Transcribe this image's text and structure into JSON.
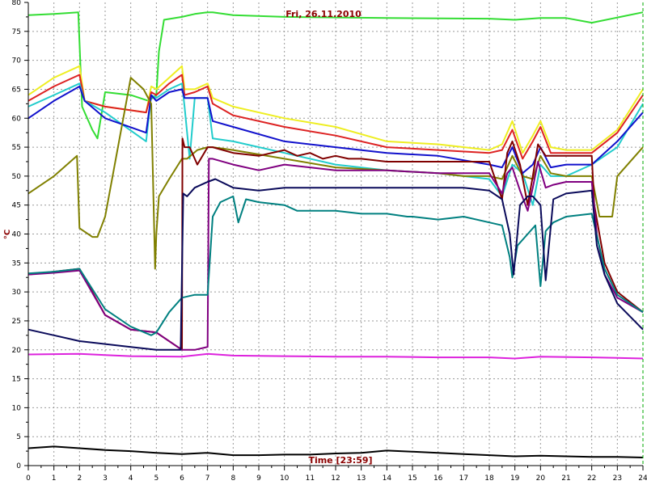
{
  "chart_data": {
    "type": "line",
    "title": "Fri, 26.11.2010",
    "xlabel": "Time [23:59]",
    "ylabel": "°C",
    "xlim": [
      0,
      24
    ],
    "ylim": [
      0,
      80
    ],
    "grid": true,
    "colors": {
      "title": "#8b0000",
      "xlabel": "#8b0000",
      "ylabel": "#8b0000",
      "grid": "#9a9a9a",
      "axis": "#000000",
      "right_edge": "#00aa00"
    },
    "series": [
      {
        "color": "#33dd33",
        "x": [
          0,
          1,
          1.95,
          2.1,
          2.5,
          2.7,
          3,
          4,
          4.7,
          5,
          5.1,
          5.3,
          6,
          6.5,
          7,
          7.2,
          8,
          10,
          14,
          18,
          19,
          20,
          21,
          22,
          24
        ],
        "y": [
          77.8,
          78,
          78.3,
          62,
          58,
          56.5,
          64.5,
          64,
          63,
          64,
          71.5,
          77,
          77.5,
          78,
          78.3,
          78.3,
          77.8,
          77.5,
          77.3,
          77.2,
          77,
          77.3,
          77.3,
          76.5,
          78.3
        ]
      },
      {
        "color": "#eeee22",
        "x": [
          0,
          1,
          2,
          2.2,
          3,
          4.6,
          4.8,
          5,
          5.5,
          6,
          6.1,
          6.5,
          7,
          7.2,
          8,
          10,
          12,
          14,
          16,
          18,
          18.5,
          18.9,
          19.3,
          19.7,
          20,
          20.4,
          21,
          22,
          23,
          24
        ],
        "y": [
          64,
          67,
          69,
          63,
          62,
          61,
          65.5,
          65,
          67,
          69,
          65,
          65,
          66,
          63.5,
          62,
          60,
          58.5,
          56,
          55.5,
          54.5,
          55.5,
          59.5,
          54,
          57,
          59.5,
          55,
          54.5,
          54.5,
          58,
          65
        ]
      },
      {
        "color": "#dd2222",
        "x": [
          0,
          1,
          2,
          2.2,
          3,
          4.6,
          4.8,
          5,
          5.5,
          6,
          6.1,
          6.5,
          7,
          7.2,
          8,
          10,
          12,
          14,
          16,
          18,
          18.5,
          18.9,
          19.3,
          19.7,
          20,
          20.4,
          21,
          22,
          23,
          24
        ],
        "y": [
          63,
          65.5,
          67.5,
          63,
          62,
          61,
          64.5,
          64,
          66,
          67.5,
          64,
          64.5,
          65.5,
          62.5,
          60.5,
          58.5,
          57,
          55,
          54.5,
          54,
          54.5,
          58,
          53,
          56,
          58.5,
          54,
          54,
          54,
          57.5,
          64
        ]
      },
      {
        "color": "#22cccc",
        "x": [
          0,
          1,
          2,
          2.2,
          3,
          4.6,
          4.8,
          5,
          5.5,
          6,
          6.1,
          6.3,
          6.5,
          7,
          7.2,
          8,
          10,
          12,
          14,
          16,
          18,
          18.5,
          18.9,
          19.3,
          19.7,
          20,
          20.4,
          21,
          22,
          23,
          24
        ],
        "y": [
          62,
          64,
          66,
          63,
          61,
          56,
          64,
          63.5,
          65,
          66,
          62,
          53,
          63.5,
          63.5,
          56.5,
          56,
          54,
          52,
          51,
          50.5,
          49.5,
          46.5,
          52,
          50.5,
          45,
          52,
          50,
          50,
          52,
          55,
          62.5
        ]
      },
      {
        "color": "#1111cc",
        "x": [
          0,
          1,
          2,
          2.2,
          3,
          4.6,
          4.8,
          5,
          5.5,
          6,
          6.1,
          6.5,
          7,
          7.2,
          8,
          10,
          12,
          14,
          16,
          18,
          18.5,
          18.9,
          19.3,
          19.7,
          20,
          20.4,
          21,
          22,
          23,
          24
        ],
        "y": [
          60,
          63,
          65.5,
          63,
          60,
          57.5,
          64,
          63,
          64.5,
          65,
          63.5,
          63.5,
          63.5,
          59.5,
          58.5,
          56,
          55,
          54,
          53.5,
          52,
          51.5,
          55,
          50.5,
          52,
          55,
          51.5,
          52,
          52,
          56,
          61
        ]
      },
      {
        "color": "#808000",
        "x": [
          0,
          1,
          1.9,
          2,
          2.5,
          2.7,
          3,
          4,
          4.5,
          4.8,
          4.95,
          5,
          5.1,
          5.5,
          6,
          6.2,
          6.6,
          7,
          7.2,
          8,
          10,
          12,
          14,
          16,
          17,
          18,
          18.5,
          18.9,
          19.3,
          19.7,
          20,
          20.4,
          21,
          22,
          22.3,
          22.8,
          23,
          24
        ],
        "y": [
          47,
          50,
          53.5,
          41,
          39.5,
          39.5,
          43,
          67,
          65,
          62.5,
          34,
          40,
          46.5,
          49.5,
          53,
          53,
          54.5,
          55,
          55,
          54.5,
          53,
          51.5,
          51,
          50.5,
          50,
          50,
          49.5,
          53.5,
          50,
          49.5,
          53.5,
          50.5,
          50,
          50,
          43,
          43,
          50,
          55
        ]
      },
      {
        "color": "#800000",
        "x": [
          0,
          1,
          2,
          3,
          4,
          5,
          6,
          6.02,
          6.1,
          6.3,
          6.6,
          7,
          7.2,
          8,
          9,
          10,
          10.5,
          11,
          11.5,
          12,
          12.5,
          13,
          14,
          15,
          16,
          17,
          18,
          18.5,
          18.7,
          18.9,
          19.2,
          19.5,
          19.7,
          19.9,
          20.2,
          20.5,
          21,
          22,
          22.1,
          22.5,
          23,
          24
        ],
        "y": [
          33,
          33.5,
          34,
          26,
          23.5,
          23,
          20,
          56.5,
          55,
          55,
          52,
          55,
          55,
          54,
          53.5,
          54.5,
          53.5,
          54,
          53,
          53.5,
          53,
          53,
          52.5,
          52.5,
          52.5,
          52.5,
          52.5,
          46,
          54,
          56,
          52,
          45,
          50,
          55.5,
          53.5,
          53.5,
          53.5,
          53.5,
          45,
          35,
          30,
          26.5
        ]
      },
      {
        "color": "#800080",
        "x": [
          0,
          1,
          2,
          3,
          4,
          5,
          6,
          6.1,
          6.5,
          7,
          7.05,
          7.2,
          8,
          9,
          10,
          11,
          12,
          14,
          16,
          18,
          18.5,
          18.7,
          18.9,
          19.2,
          19.5,
          19.7,
          19.9,
          20.2,
          20.5,
          21,
          22,
          22.2,
          22.5,
          23,
          24
        ],
        "y": [
          33,
          33.3,
          33.7,
          26,
          23.5,
          23,
          20,
          20,
          20,
          20.5,
          53,
          53,
          52,
          51,
          52,
          51.5,
          51,
          51,
          50.5,
          50.5,
          47,
          50.5,
          51.5,
          47.5,
          44,
          48,
          52.5,
          48,
          48.5,
          49,
          49,
          40,
          33,
          29,
          26.5
        ]
      },
      {
        "color": "#008080",
        "x": [
          0,
          1,
          2,
          3,
          4,
          4.8,
          5,
          5.5,
          6,
          6.5,
          7,
          7.2,
          7.5,
          8,
          8.2,
          8.5,
          9,
          10,
          10.5,
          11,
          12,
          13,
          14,
          14.8,
          15,
          16,
          17,
          18,
          18.5,
          18.8,
          18.9,
          19.1,
          19.5,
          19.8,
          20,
          20.2,
          20.5,
          21,
          22,
          22.5,
          23,
          24
        ],
        "y": [
          33.2,
          33.5,
          34,
          27,
          24,
          22.5,
          23,
          26.5,
          29,
          29.5,
          29.5,
          43,
          45.5,
          46.5,
          42,
          46,
          45.5,
          45,
          44,
          44,
          44,
          43.5,
          43.5,
          43,
          43,
          42.5,
          43,
          42,
          41.5,
          36,
          32.5,
          38,
          40,
          41.5,
          31,
          40.5,
          42,
          43,
          43.5,
          34,
          29.5,
          26.5
        ]
      },
      {
        "color": "#0a0a5a",
        "x": [
          0,
          1,
          2,
          3,
          4,
          5,
          5.95,
          6.05,
          6.2,
          6.5,
          7,
          7.3,
          8,
          9,
          10,
          11,
          12,
          14,
          16,
          17,
          18,
          18.5,
          18.8,
          18.95,
          19.2,
          19.5,
          19.7,
          20,
          20.2,
          20.5,
          21,
          22,
          22.2,
          22.5,
          23,
          24
        ],
        "y": [
          23.5,
          22.5,
          21.5,
          21,
          20.5,
          20,
          20,
          47,
          46.5,
          48,
          49,
          49.5,
          48,
          47.5,
          48,
          48,
          48,
          48,
          48,
          48,
          47.5,
          46,
          40,
          33,
          45,
          46.5,
          46.5,
          45,
          32,
          46,
          47,
          47.5,
          38,
          33,
          28,
          23.5
        ]
      },
      {
        "color": "#dd22dd",
        "x": [
          0,
          2,
          4,
          6,
          7,
          8,
          10,
          12,
          14,
          16,
          18,
          19,
          20,
          22,
          24
        ],
        "y": [
          19.2,
          19.3,
          18.9,
          18.8,
          19.3,
          19,
          18.9,
          18.8,
          18.8,
          18.7,
          18.7,
          18.5,
          18.8,
          18.7,
          18.5
        ]
      },
      {
        "color": "#000000",
        "x": [
          0,
          1,
          2,
          3,
          4,
          5,
          6,
          7,
          8,
          9,
          10,
          11,
          12,
          13,
          14,
          15,
          16,
          17,
          18,
          19,
          20,
          21,
          22,
          23,
          24
        ],
        "y": [
          3,
          3.3,
          3,
          2.7,
          2.5,
          2.2,
          2,
          2.2,
          1.8,
          1.8,
          1.9,
          1.9,
          2.1,
          2.2,
          2.6,
          2.4,
          2.2,
          2,
          1.8,
          1.6,
          1.7,
          1.6,
          1.5,
          1.5,
          1.4
        ]
      }
    ]
  }
}
